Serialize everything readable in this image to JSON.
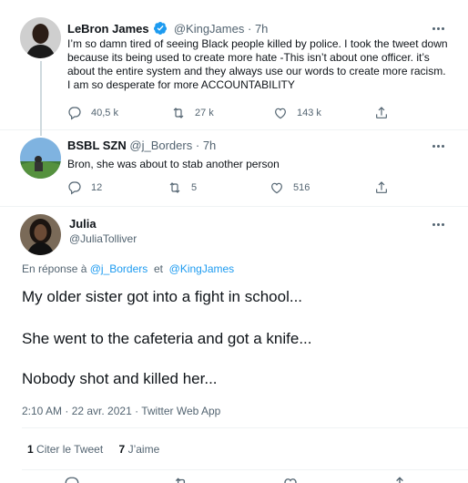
{
  "colors": {
    "accent": "#1d9bf0",
    "secondary_text": "#536471",
    "primary_text": "#0f1419",
    "line": "#cfd9de"
  },
  "tweets": [
    {
      "name": "LeBron James",
      "handle": "@KingJames",
      "separator": "·",
      "time": "7h",
      "verified": true,
      "text": "I’m so damn tired of seeing Black people killed by police. I took the tweet down because its being used to create more hate -This isn’t about one officer.  it’s about the entire system and they always use our words to create more racism. I am so desperate for more ACCOUNTABILITY",
      "replies": "40,5 k",
      "retweets": "27 k",
      "likes": "143 k"
    },
    {
      "name": "BSBL SZN",
      "handle": "@j_Borders",
      "separator": "·",
      "time": "7h",
      "text": "Bron, she was about to stab another person",
      "replies": "12",
      "retweets": "5",
      "likes": "516"
    }
  ],
  "main_tweet": {
    "name": "Julia",
    "handle": "@JuliaTolliver",
    "reply_prefix": "En réponse à",
    "reply_user_1": "@j_Borders",
    "reply_joiner": "et",
    "reply_user_2": "@KingJames",
    "lines": [
      "My older sister got into a fight in school...",
      "She went to the cafeteria and got a knife...",
      "Nobody shot and killed her..."
    ],
    "timestamp": "2:10 AM · 22 avr. 2021 · ",
    "source": "Twitter Web App",
    "quote_count": "1",
    "quote_label": "Citer le Tweet",
    "like_count": "7",
    "like_label": "J’aime"
  }
}
